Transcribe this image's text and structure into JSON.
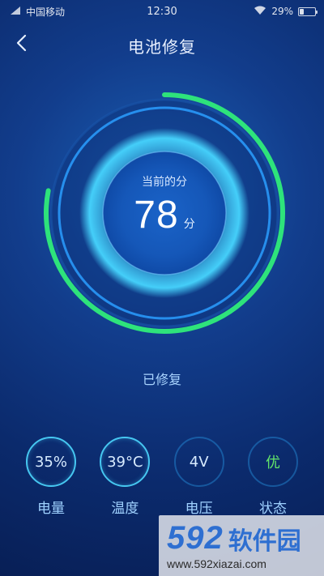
{
  "status_bar": {
    "carrier": "中国移动",
    "time": "12:30",
    "battery_percent": "29%",
    "battery_fill_fraction": 0.29,
    "icons": [
      "signal-icon",
      "wifi-icon",
      "battery-icon"
    ]
  },
  "header": {
    "title": "电池修复",
    "back_icon": "chevron-left-icon"
  },
  "gauge": {
    "label": "当前的分",
    "score": "78",
    "unit": "分",
    "progress_fraction": 0.78,
    "colors": {
      "progress": "#2ee37b",
      "ring": "#2a9dff",
      "glow": "#47d6ff"
    }
  },
  "repair_status": "已修复",
  "metrics": [
    {
      "value": "35%",
      "label": "电量"
    },
    {
      "value": "39°C",
      "label": "温度"
    },
    {
      "value": "4V",
      "label": "电压"
    },
    {
      "value": "优",
      "label": "状态"
    }
  ],
  "watermark": {
    "logo_number": "592",
    "logo_text": "软件园",
    "url": "www.592xiazai.com"
  }
}
